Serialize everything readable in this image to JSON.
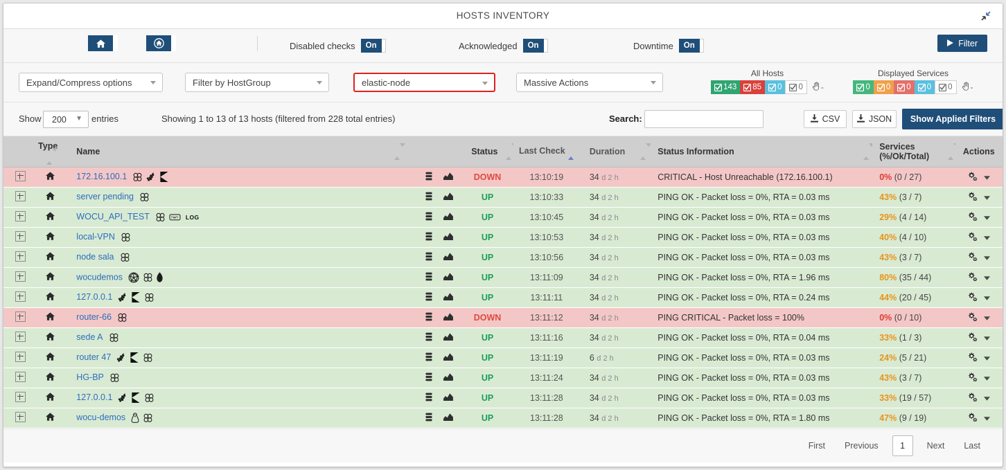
{
  "window": {
    "title": "HOSTS INVENTORY",
    "collapse_icon": "compress-arrows-icon"
  },
  "toolbar": {
    "home_button_icon": "home-icon",
    "home_circle_button_icon": "home-circle-icon",
    "toggles": [
      {
        "label": "Disabled checks",
        "value": "On"
      },
      {
        "label": "Acknowledged",
        "value": "On"
      },
      {
        "label": "Downtime",
        "value": "On"
      }
    ],
    "filter_button": "Filter",
    "filter_button_icon": "play-icon"
  },
  "filters": {
    "expand_compress": "Expand/Compress options",
    "hostgroup": "Filter by HostGroup",
    "elastic_node": "elastic-node",
    "massive_actions": "Massive Actions",
    "highlight_color": "#e02020"
  },
  "stats": {
    "all_hosts": {
      "caption": "All Hosts",
      "badges": [
        {
          "value": "143",
          "color": "#2fa572"
        },
        {
          "value": "85",
          "color": "#d9413c"
        },
        {
          "value": "0",
          "color": "#5bc0de"
        },
        {
          "value": "0",
          "color": "#ffffff"
        }
      ],
      "hand_label": "-"
    },
    "displayed_services": {
      "caption": "Displayed Services",
      "badges": [
        {
          "value": "0",
          "color": "#45b77d"
        },
        {
          "value": "0",
          "color": "#f0a04b"
        },
        {
          "value": "0",
          "color": "#e2706a"
        },
        {
          "value": "0",
          "color": "#5bc0de"
        },
        {
          "value": "0",
          "color": "#ffffff"
        }
      ],
      "hand_label": "-"
    }
  },
  "controls": {
    "show_label": "Show",
    "show_value": "200",
    "entries_label": "entries",
    "showing_info": "Showing 1 to 13 of 13 hosts (filtered from 228 total entries)",
    "search_label": "Search:",
    "search_value": "",
    "search_placeholder": "",
    "csv_button": "CSV",
    "json_button": "JSON",
    "download_icon": "download-icon",
    "applied_filters_button": "Show Applied Filters"
  },
  "table": {
    "columns": [
      {
        "key": "type",
        "label": "Type",
        "sortable": true
      },
      {
        "key": "name",
        "label": "Name",
        "sortable": true
      },
      {
        "key": "status",
        "label": "Status",
        "sortable": true
      },
      {
        "key": "last_check",
        "label": "Last Check",
        "sortable": true,
        "sorted": "asc"
      },
      {
        "key": "duration",
        "label": "Duration",
        "sortable": true
      },
      {
        "key": "status_information",
        "label": "Status Information",
        "sortable": true
      },
      {
        "key": "services",
        "label": "Services\n(%/Ok/Total)",
        "sortable": true
      },
      {
        "key": "actions",
        "label": "Actions",
        "sortable": false
      }
    ],
    "rows": [
      {
        "name": "172.16.100.1",
        "icons": [
          "cluster-icon",
          "grapes-icon",
          "flag-icon"
        ],
        "status": "DOWN",
        "last_check": "13:10:19",
        "duration_num": "34",
        "duration_unit": "d 2 h",
        "status_information": "CRITICAL - Host Unreachable (172.16.100.1)",
        "pct": "0%",
        "counts": "(0 / 27)",
        "state": "down"
      },
      {
        "name": "server pending",
        "icons": [
          "cluster-icon"
        ],
        "status": "UP",
        "last_check": "13:10:33",
        "duration_num": "34",
        "duration_unit": "d 2 h",
        "status_information": "PING OK - Packet loss = 0%, RTA = 0.03 ms",
        "pct": "43%",
        "counts": "(3 / 7)",
        "state": "up"
      },
      {
        "name": "WOCU_API_TEST",
        "icons": [
          "cluster-icon",
          "keyboard-icon",
          "log-tag"
        ],
        "status": "UP",
        "last_check": "13:10:45",
        "duration_num": "34",
        "duration_unit": "d 2 h",
        "status_information": "PING OK - Packet loss = 0%, RTA = 0.03 ms",
        "pct": "29%",
        "counts": "(4 / 14)",
        "state": "up"
      },
      {
        "name": "local-VPN",
        "icons": [
          "cluster-icon"
        ],
        "status": "UP",
        "last_check": "13:10:53",
        "duration_num": "34",
        "duration_unit": "d 2 h",
        "status_information": "PING OK - Packet loss = 0%, RTA = 0.03 ms",
        "pct": "40%",
        "counts": "(4 / 10)",
        "state": "up"
      },
      {
        "name": "node sala",
        "icons": [
          "cluster-icon"
        ],
        "status": "UP",
        "last_check": "13:10:56",
        "duration_num": "34",
        "duration_unit": "d 2 h",
        "status_information": "PING OK - Packet loss = 0%, RTA = 0.03 ms",
        "pct": "43%",
        "counts": "(3 / 7)",
        "state": "up"
      },
      {
        "name": "wocudemos",
        "icons": [
          "globe-icon",
          "cluster-icon",
          "leaf-icon"
        ],
        "status": "UP",
        "last_check": "13:11:09",
        "duration_num": "34",
        "duration_unit": "d 2 h",
        "status_information": "PING OK - Packet loss = 0%, RTA = 1.96 ms",
        "pct": "80%",
        "counts": "(35 / 44)",
        "state": "up"
      },
      {
        "name": "127.0.0.1",
        "icons": [
          "grapes-icon",
          "flag-icon",
          "cluster-icon"
        ],
        "status": "UP",
        "last_check": "13:11:11",
        "duration_num": "34",
        "duration_unit": "d 2 h",
        "status_information": "PING OK - Packet loss = 0%, RTA = 0.24 ms",
        "pct": "44%",
        "counts": "(20 / 45)",
        "state": "up"
      },
      {
        "name": "router-66",
        "icons": [
          "cluster-icon"
        ],
        "status": "DOWN",
        "last_check": "13:11:12",
        "duration_num": "34",
        "duration_unit": "d 2 h",
        "status_information": "PING CRITICAL - Packet loss = 100%",
        "pct": "0%",
        "counts": "(0 / 10)",
        "state": "down"
      },
      {
        "name": "sede A",
        "icons": [
          "cluster-icon"
        ],
        "status": "UP",
        "last_check": "13:11:16",
        "duration_num": "34",
        "duration_unit": "d 2 h",
        "status_information": "PING OK - Packet loss = 0%, RTA = 0.04 ms",
        "pct": "33%",
        "counts": "(1 / 3)",
        "state": "up"
      },
      {
        "name": "router 47",
        "icons": [
          "grapes-icon",
          "flag-icon",
          "cluster-icon"
        ],
        "status": "UP",
        "last_check": "13:11:19",
        "duration_num": "6",
        "duration_unit": "d 2 h",
        "status_information": "PING OK - Packet loss = 0%, RTA = 0.03 ms",
        "pct": "24%",
        "counts": "(5 / 21)",
        "state": "up"
      },
      {
        "name": "HG-BP",
        "icons": [
          "cluster-icon"
        ],
        "status": "UP",
        "last_check": "13:11:24",
        "duration_num": "34",
        "duration_unit": "d 2 h",
        "status_information": "PING OK - Packet loss = 0%, RTA = 0.03 ms",
        "pct": "43%",
        "counts": "(3 / 7)",
        "state": "up"
      },
      {
        "name": "127.0.0.1",
        "icons": [
          "grapes-icon",
          "flag-icon",
          "cluster-icon"
        ],
        "status": "UP",
        "last_check": "13:11:28",
        "duration_num": "34",
        "duration_unit": "d 2 h",
        "status_information": "PING OK - Packet loss = 0%, RTA = 0.03 ms",
        "pct": "33%",
        "counts": "(19 / 57)",
        "state": "up"
      },
      {
        "name": "wocu-demos",
        "icons": [
          "linux-icon",
          "cluster-icon"
        ],
        "status": "UP",
        "last_check": "13:11:28",
        "duration_num": "34",
        "duration_unit": "d 2 h",
        "status_information": "PING OK - Packet loss = 0%, RTA = 1.80 ms",
        "pct": "47%",
        "counts": "(9 / 19)",
        "state": "up"
      }
    ]
  },
  "pagination": {
    "first": "First",
    "previous": "Previous",
    "current": "1",
    "next": "Next",
    "last": "Last"
  }
}
